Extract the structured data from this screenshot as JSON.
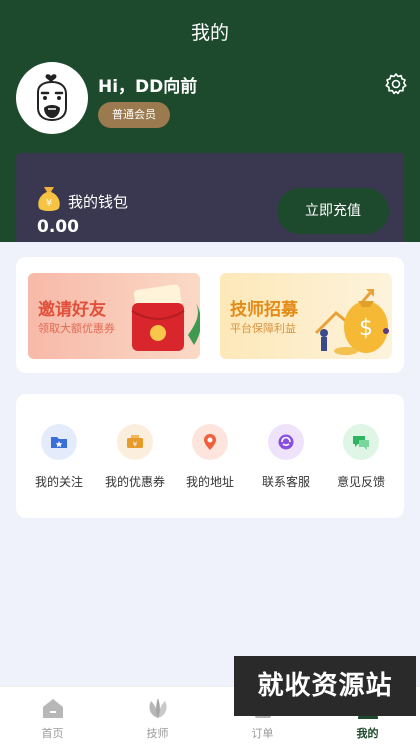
{
  "page": {
    "title": "我的"
  },
  "profile": {
    "greeting": "Hi，DD向前",
    "member_level": "普通会员"
  },
  "wallet": {
    "title": "我的钱包",
    "balance": "0.00",
    "recharge_label": "立即充值"
  },
  "promotions": [
    {
      "title": "邀请好友",
      "subtitle": "领取大额优惠券"
    },
    {
      "title": "技师招募",
      "subtitle": "平台保障利益"
    }
  ],
  "services": [
    {
      "label": "我的关注",
      "icon": "folder-star-icon",
      "color": "#3a6fd8"
    },
    {
      "label": "我的优惠券",
      "icon": "coupon-icon",
      "color": "#e79b2c"
    },
    {
      "label": "我的地址",
      "icon": "location-pin-icon",
      "color": "#f0603a"
    },
    {
      "label": "联系客服",
      "icon": "customer-service-icon",
      "color": "#8b4fe0"
    },
    {
      "label": "意见反馈",
      "icon": "feedback-chat-icon",
      "color": "#2fb463"
    }
  ],
  "tabbar": {
    "items": [
      {
        "label": "首页",
        "icon": "home-icon"
      },
      {
        "label": "技师",
        "icon": "leaf-icon"
      },
      {
        "label": "订单",
        "icon": "order-icon"
      },
      {
        "label": "我的",
        "icon": "user-icon",
        "active": true
      }
    ]
  },
  "watermark": {
    "text": "就收资源站"
  },
  "colors": {
    "primary": "#1d4a2d",
    "wallet_card": "#393850",
    "badge": "#9a7a4e",
    "background": "#f0f2fb"
  }
}
